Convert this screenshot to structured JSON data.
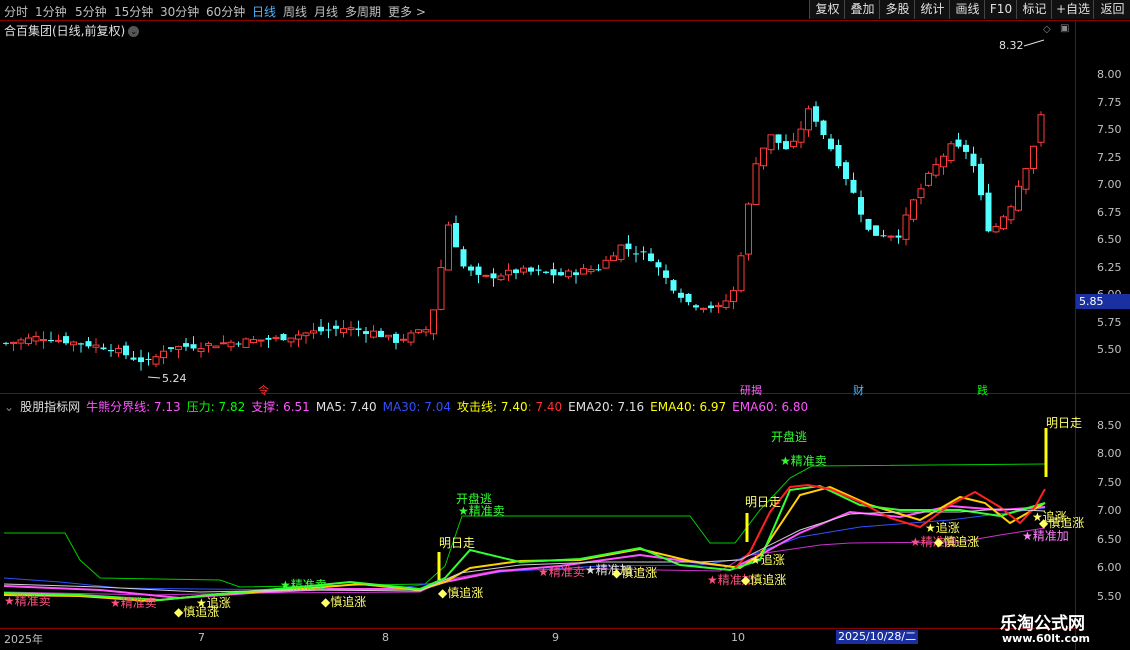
{
  "toolbar": {
    "periods": [
      "分时",
      "1分钟",
      "5分钟",
      "15分钟",
      "30分钟",
      "60分钟",
      "日线",
      "周线",
      "月线",
      "多周期",
      "更多 >"
    ],
    "active_period": "日线",
    "right_buttons": [
      "复权",
      "叠加",
      "多股",
      "统计",
      "画线",
      "F10",
      "标记",
      "+自选",
      "返回"
    ]
  },
  "chart_title": "合百集团(日线,前复权)",
  "main_chart": {
    "high_label": "8.32",
    "low_label": "5.24",
    "current_price": "5.85",
    "y_ticks": [
      "8.00",
      "7.75",
      "7.50",
      "7.25",
      "7.00",
      "6.75",
      "6.50",
      "6.25",
      "6.00",
      "5.75",
      "5.50"
    ],
    "events": [
      {
        "label": "令",
        "color": "#ff3030"
      },
      {
        "label": "研揭",
        "color": "#ff66ff"
      },
      {
        "label": "财",
        "color": "#4fb3ff"
      },
      {
        "label": "践",
        "color": "#00ff00"
      }
    ]
  },
  "indicator": {
    "name": "股朋指标网",
    "items": [
      {
        "label": "牛熊分界线: 7.13",
        "color": "#ff55ff"
      },
      {
        "label": "压力: 7.82",
        "color": "#00ff00"
      },
      {
        "label": "支撑: 6.51",
        "color": "#ff55ff"
      },
      {
        "label": "MA5: 7.40",
        "color": "#e0e0e0"
      },
      {
        "label": "MA30: 7.04",
        "color": "#3050ff"
      },
      {
        "label": "攻击线: 7.40",
        "color": "#ffff00"
      },
      {
        "label": ": 7.40",
        "color": "#ff3030"
      },
      {
        "label": "EMA20: 7.16",
        "color": "#e0e0e0"
      },
      {
        "label": "EMA40: 6.97",
        "color": "#ffff00"
      },
      {
        "label": "EMA60: 6.80",
        "color": "#ff55ff"
      }
    ],
    "y_ticks": [
      "8.50",
      "8.00",
      "7.50",
      "7.00",
      "6.50",
      "6.00",
      "5.50"
    ],
    "signals": {
      "open_escape": "开盘逃",
      "precise_sell": "★精准卖",
      "tomorrow_go": "明日走",
      "chase_up": "追涨",
      "careful_chase": "慎追涨",
      "precise_add": "★精准加"
    }
  },
  "x_axis": {
    "labels": [
      "2025年",
      "7",
      "8",
      "9",
      "10"
    ],
    "cursor_date": "2025/10/28/二"
  },
  "watermark": {
    "line1": "乐淘公式网",
    "line2": "www.60lt.com"
  }
}
